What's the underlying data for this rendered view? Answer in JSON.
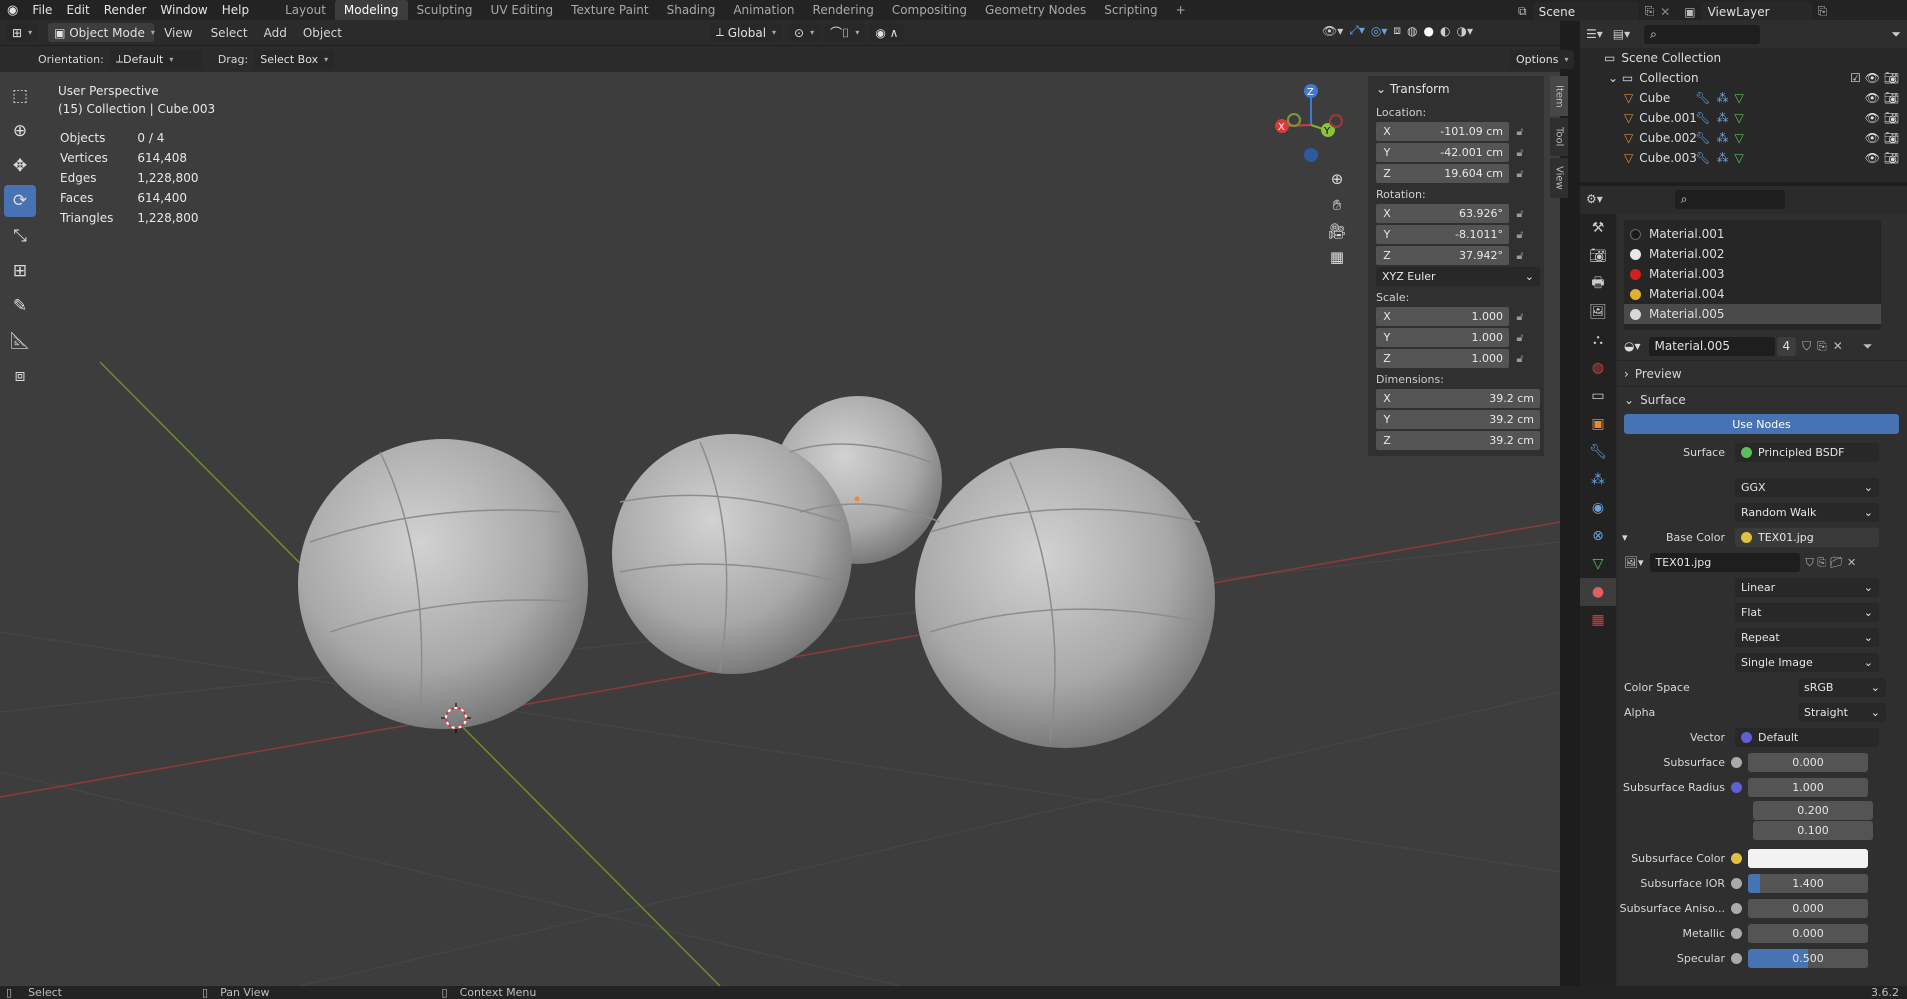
{
  "menu": [
    "File",
    "Edit",
    "Render",
    "Window",
    "Help"
  ],
  "workspaces": [
    "Layout",
    "Modeling",
    "Sculpting",
    "UV Editing",
    "Texture Paint",
    "Shading",
    "Animation",
    "Rendering",
    "Compositing",
    "Geometry Nodes",
    "Scripting"
  ],
  "active_workspace": "Modeling",
  "scene": "Scene",
  "viewlayer": "ViewLayer",
  "header": {
    "mode": "Object Mode",
    "view": "View",
    "select": "Select",
    "add": "Add",
    "object": "Object",
    "transform": "Global",
    "orientation_label": "Orientation:",
    "orientation": "Default",
    "drag_label": "Drag:",
    "drag": "Select Box",
    "options": "Options"
  },
  "viewport": {
    "perspective": "User Perspective",
    "collection": "(15) Collection | Cube.003"
  },
  "stats": [
    {
      "k": "Objects",
      "v": "0 / 4"
    },
    {
      "k": "Vertices",
      "v": "614,408"
    },
    {
      "k": "Edges",
      "v": "1,228,800"
    },
    {
      "k": "Faces",
      "v": "614,400"
    },
    {
      "k": "Triangles",
      "v": "1,228,800"
    }
  ],
  "transform": {
    "title": "Transform",
    "location_label": "Location:",
    "loc": [
      "-101.09 cm",
      "-42.001 cm",
      "19.604 cm"
    ],
    "rotation_label": "Rotation:",
    "rot": [
      "63.926°",
      "-8.1011°",
      "37.942°"
    ],
    "rotation_mode": "XYZ Euler",
    "scale_label": "Scale:",
    "scale": [
      "1.000",
      "1.000",
      "1.000"
    ],
    "dimensions_label": "Dimensions:",
    "dim": [
      "39.2 cm",
      "39.2 cm",
      "39.2 cm"
    ]
  },
  "axes": [
    "X",
    "Y",
    "Z"
  ],
  "sidetabs": [
    "Item",
    "Tool",
    "View"
  ],
  "outliner": {
    "scene_collection": "Scene Collection",
    "collection": "Collection",
    "objects": [
      "Cube",
      "Cube.001",
      "Cube.002",
      "Cube.003"
    ]
  },
  "materials": [
    {
      "name": "Material.001",
      "color": "#1a1a1a"
    },
    {
      "name": "Material.002",
      "color": "#e8e8e8"
    },
    {
      "name": "Material.003",
      "color": "#d02020"
    },
    {
      "name": "Material.004",
      "color": "#e0b030"
    },
    {
      "name": "Material.005",
      "color": "#d8d8d8"
    }
  ],
  "material_slot": {
    "name": "Material.005",
    "users": "4"
  },
  "panels": {
    "preview": "Preview",
    "surface": "Surface",
    "use_nodes": "Use Nodes"
  },
  "props": {
    "surface_label": "Surface",
    "surface": "Principled BSDF",
    "dist": "GGX",
    "sss_method": "Random Walk",
    "base_color_label": "Base Color",
    "base_color": "TEX01.jpg",
    "image": "TEX01.jpg",
    "interp": "Linear",
    "proj": "Flat",
    "ext": "Repeat",
    "source": "Single Image",
    "color_space_label": "Color Space",
    "color_space": "sRGB",
    "alpha_label": "Alpha",
    "alpha": "Straight",
    "vector_label": "Vector",
    "vector": "Default",
    "subsurface_label": "Subsurface",
    "subsurface": "0.000",
    "sss_radius_label": "Subsurface Radius",
    "sss_radius": [
      "1.000",
      "0.200",
      "0.100"
    ],
    "sss_color_label": "Subsurface Color",
    "sss_ior_label": "Subsurface IOR",
    "sss_ior": "1.400",
    "sss_aniso_label": "Subsurface Aniso...",
    "sss_aniso": "0.000",
    "metallic_label": "Metallic",
    "metallic": "0.000",
    "specular_label": "Specular",
    "specular": "0.500"
  },
  "status": {
    "select": "Select",
    "pan": "Pan View",
    "context": "Context Menu",
    "version": "3.6.2"
  }
}
